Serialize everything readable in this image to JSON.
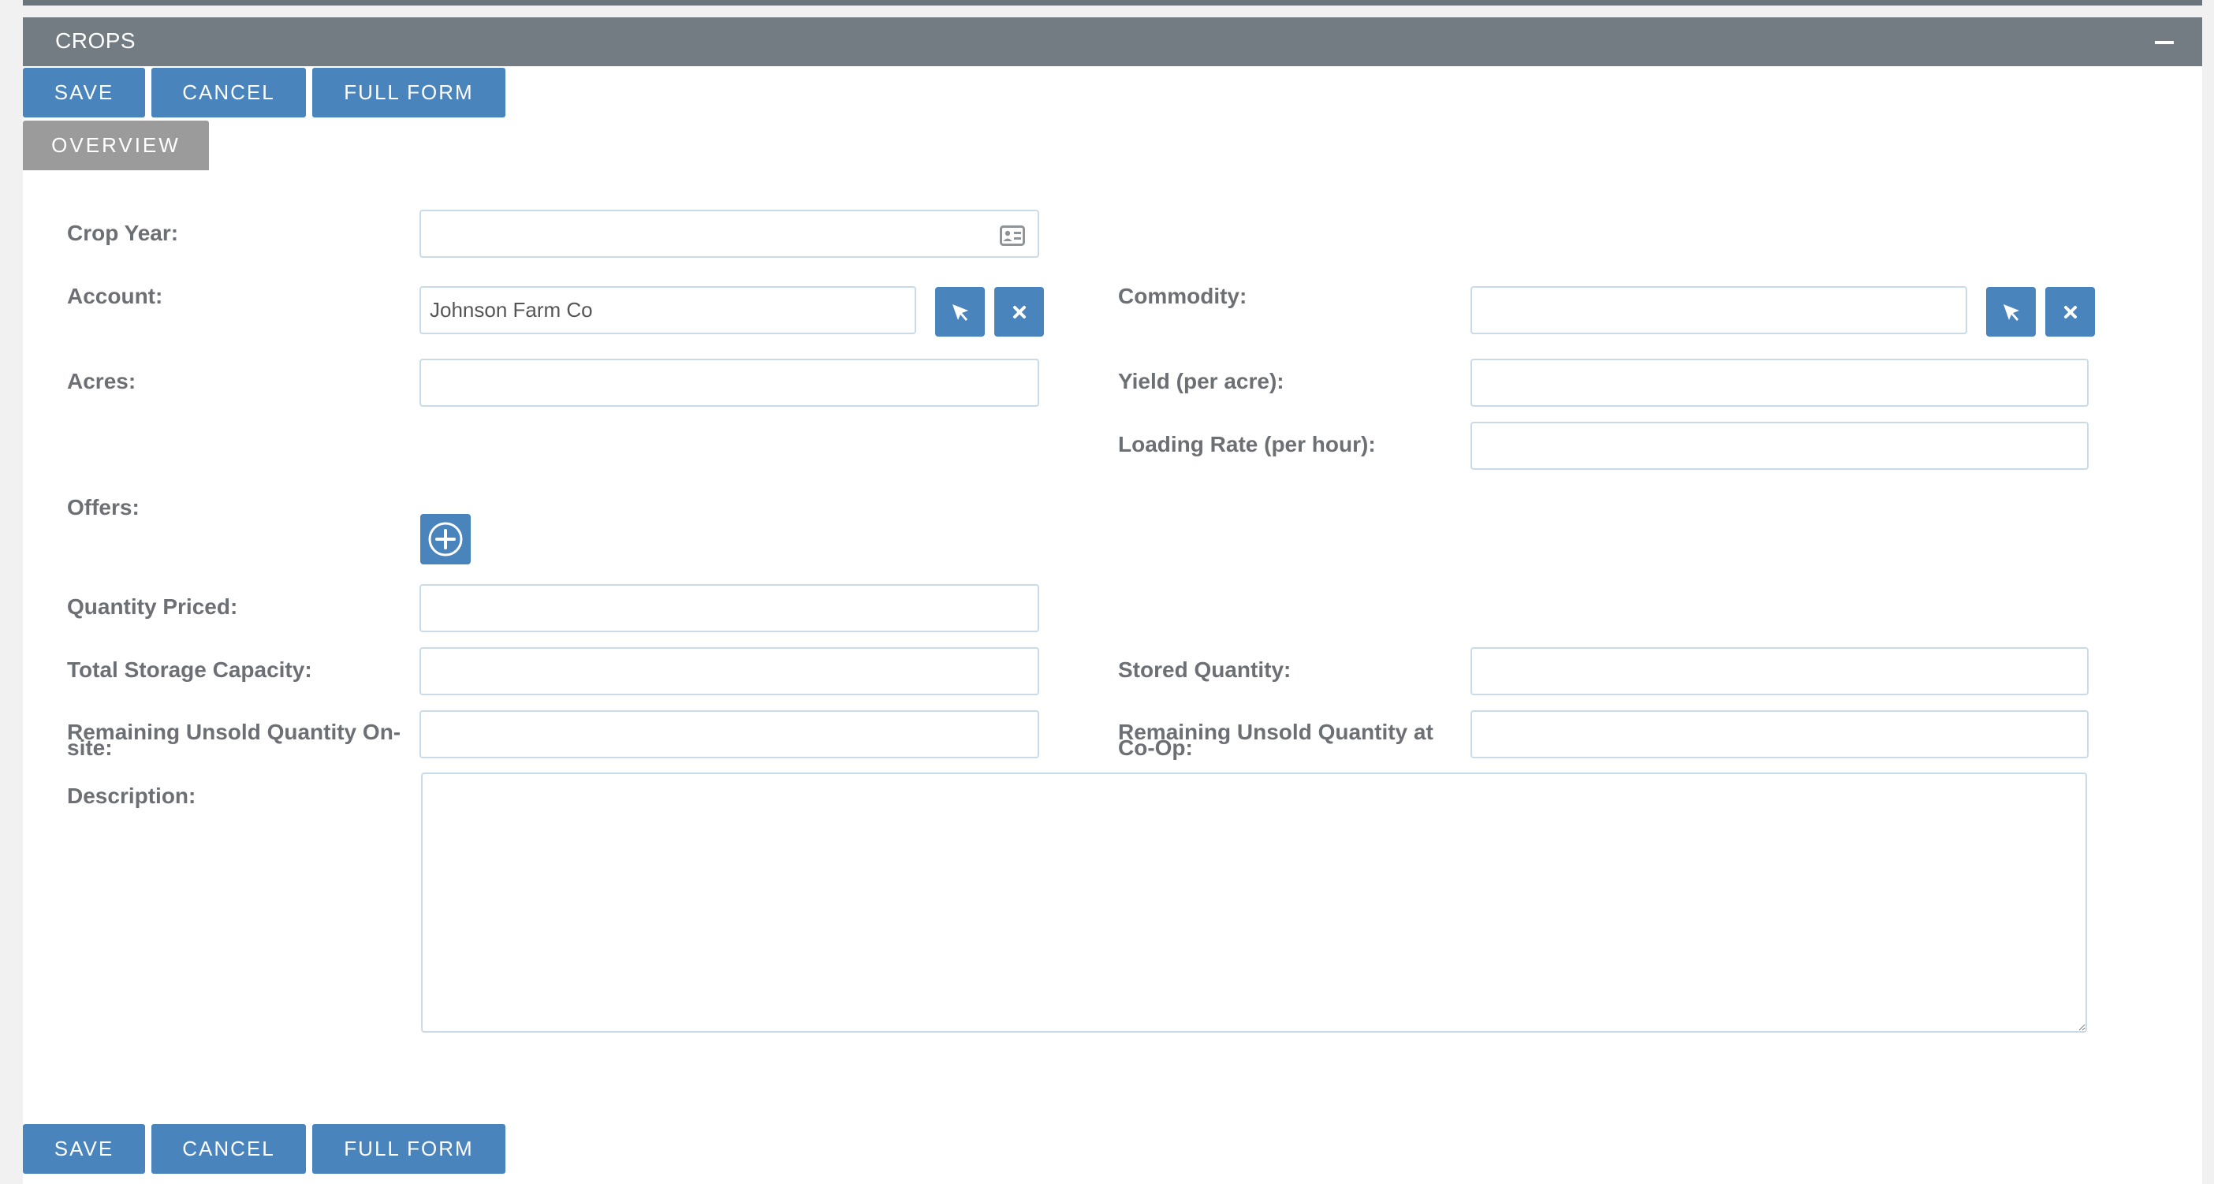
{
  "panel": {
    "title": "CROPS"
  },
  "toolbar": {
    "save": "SAVE",
    "cancel": "CANCEL",
    "full_form": "FULL FORM"
  },
  "tabs": {
    "overview": "OVERVIEW"
  },
  "form": {
    "crop_year": {
      "label": "Crop Year:",
      "value": ""
    },
    "account": {
      "label": "Account:",
      "value": "Johnson Farm Co"
    },
    "commodity": {
      "label": "Commodity:",
      "value": ""
    },
    "acres": {
      "label": "Acres:",
      "value": ""
    },
    "yield": {
      "label": "Yield (per acre):",
      "value": ""
    },
    "loading_rate": {
      "label": "Loading Rate (per hour):",
      "value": ""
    },
    "offers": {
      "label": "Offers:"
    },
    "quantity_priced": {
      "label": "Quantity Priced:",
      "value": ""
    },
    "total_storage": {
      "label": "Total Storage Capacity:",
      "value": ""
    },
    "stored_quantity": {
      "label": "Stored Quantity:",
      "value": ""
    },
    "remaining_onsite": {
      "label": "Remaining Unsold Quantity On-site:",
      "value": ""
    },
    "remaining_coop": {
      "label": "Remaining Unsold Quantity at Co-Op:",
      "value": ""
    },
    "description": {
      "label": "Description:",
      "value": ""
    }
  },
  "icons": {
    "calendar": "calendar-icon",
    "select": "cursor-arrow-icon",
    "clear": "close-icon",
    "add": "plus-circle-icon",
    "collapse": "minus-icon"
  },
  "colors": {
    "header": "#727c82",
    "button": "#4a84bc",
    "tab": "#9b9b9b",
    "label": "#6c6f73",
    "field_border": "#c9dbe8"
  }
}
